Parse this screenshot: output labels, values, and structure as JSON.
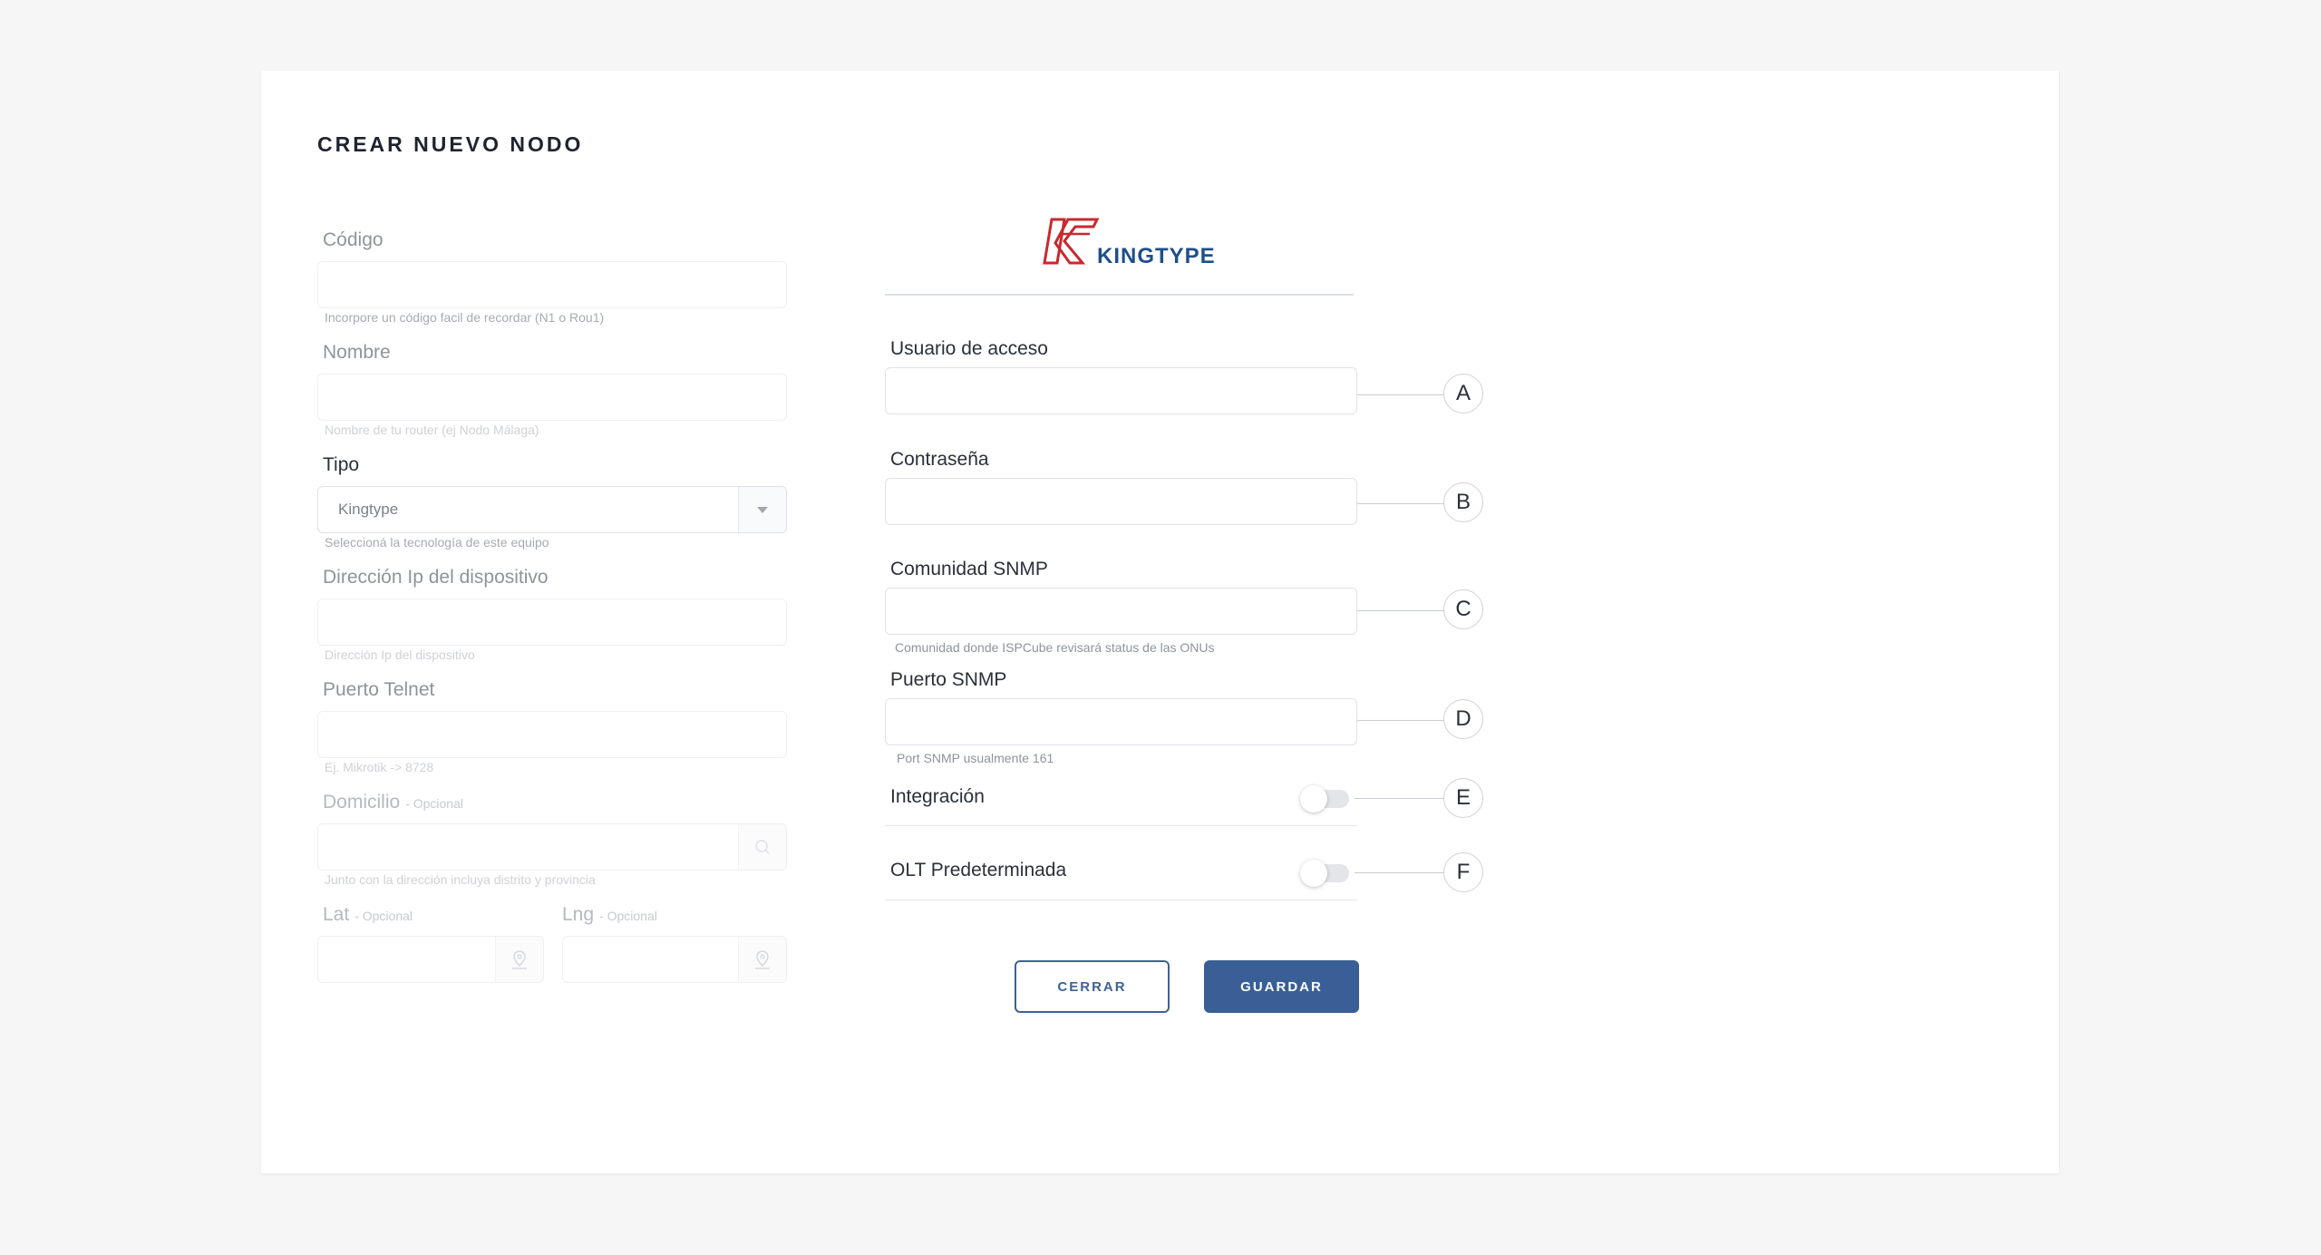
{
  "modal": {
    "title": "CREAR NUEVO NODO",
    "optional_tag": "- Opcional"
  },
  "left": {
    "codigo": {
      "label": "Código",
      "value": "",
      "hint": "Incorpore un código facil de recordar (N1 o Rou1)"
    },
    "nombre": {
      "label": "Nombre",
      "value": "",
      "hint": "Nombre de tu router (ej Nodo Málaga)"
    },
    "tipo": {
      "label": "Tipo",
      "value": "Kingtype",
      "hint": "Seleccioná la tecnología de este equipo"
    },
    "ip": {
      "label": "Dirección Ip del dispositivo",
      "value": "",
      "hint": "Dirección Ip del dispositivo"
    },
    "telnet": {
      "label": "Puerto Telnet",
      "value": "",
      "hint": "Ej. Mikrotik -> 8728"
    },
    "domicilio": {
      "label": "Domicilio",
      "value": "",
      "hint": "Junto con la dirección incluya distrito y provincia"
    },
    "lat": {
      "label": "Lat",
      "value": ""
    },
    "lng": {
      "label": "Lng",
      "value": ""
    }
  },
  "right": {
    "brand": "KINGTYPE",
    "usuario": {
      "label": "Usuario de acceso",
      "value": "",
      "marker": "A"
    },
    "contrasena": {
      "label": "Contraseña",
      "value": "",
      "marker": "B"
    },
    "comunidad": {
      "label": "Comunidad SNMP",
      "value": "",
      "hint": "Comunidad donde ISPCube revisará status de las ONUs",
      "marker": "C"
    },
    "puerto_snmp": {
      "label": "Puerto SNMP",
      "value": "",
      "hint": "Port SNMP usualmente 161",
      "marker": "D"
    },
    "integracion": {
      "label": "Integración",
      "enabled": false,
      "marker": "E"
    },
    "olt": {
      "label": "OLT Predeterminada",
      "enabled": false,
      "marker": "F"
    }
  },
  "buttons": {
    "close": "CERRAR",
    "save": "GUARDAR"
  },
  "colors": {
    "primary": "#3a5f97",
    "logo_red": "#c8282e",
    "logo_blue": "#1f4f8a"
  }
}
